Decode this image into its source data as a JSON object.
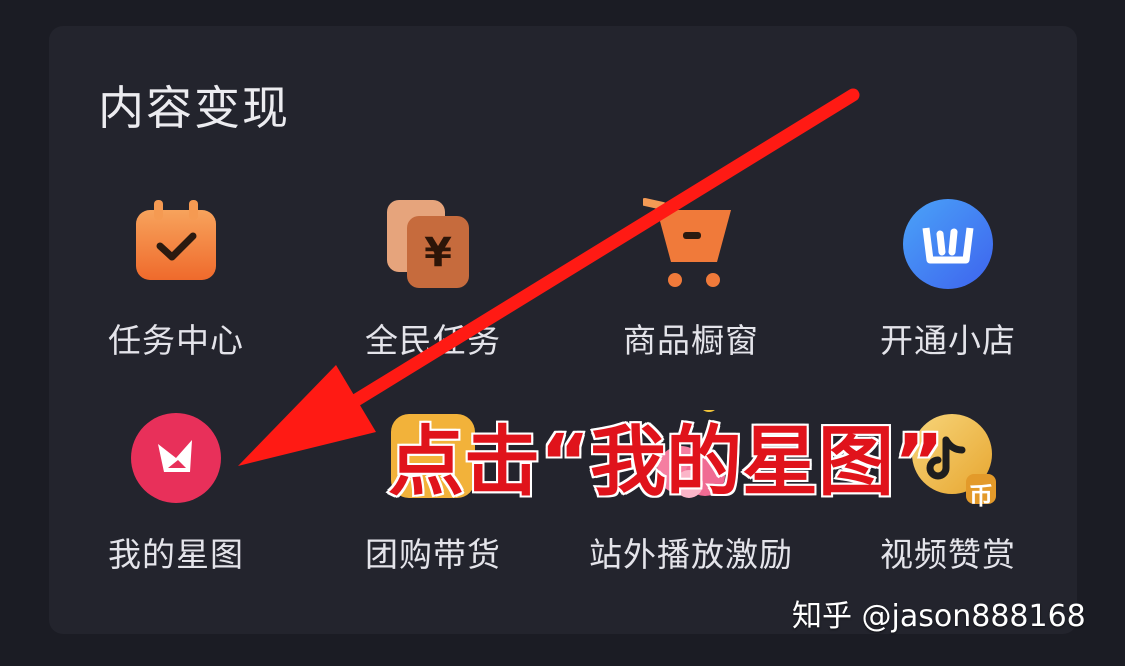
{
  "section": {
    "title": "内容变现"
  },
  "items": [
    {
      "label": "任务中心"
    },
    {
      "label": "全民任务"
    },
    {
      "label": "商品橱窗"
    },
    {
      "label": "开通小店"
    },
    {
      "label": "我的星图"
    },
    {
      "label": "团购带货"
    },
    {
      "label": "站外播放激励"
    },
    {
      "label": "视频赞赏"
    }
  ],
  "annotation": {
    "callout": "点击“我的星图”",
    "coin_badge": "币"
  },
  "watermark": {
    "text": "知乎 @jason888168"
  },
  "colors": {
    "background": "#1b1c24",
    "card": "#23242d",
    "orange_icon": "#f07a3a",
    "xingtu_pink": "#e8305a",
    "shop_blue": "#3f7bf2",
    "arrow_red": "#ff1a14"
  },
  "icons": [
    "calendar-check-icon",
    "yuan-cards-icon",
    "shopping-cart-icon",
    "shop-logo-icon",
    "xingtu-logo-icon",
    "group-buy-icon",
    "offsite-play-icon",
    "video-reward-coin-icon"
  ]
}
